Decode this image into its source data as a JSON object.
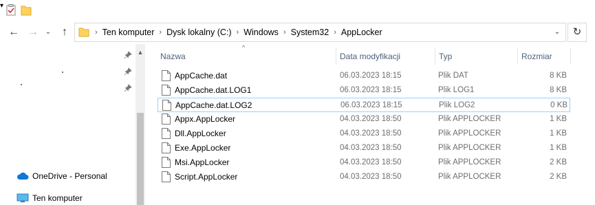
{
  "quick_access": {
    "icons": [
      "properties-icon",
      "new-folder-icon",
      "customize-dropdown-icon"
    ],
    "dropdown_glyph": "▾"
  },
  "nav": {
    "back_glyph": "←",
    "forward_glyph": "→",
    "recent_glyph": "⌄",
    "up_glyph": "↑",
    "refresh_glyph": "↻",
    "address_dropdown_glyph": "⌄",
    "breadcrumb": [
      "Ten komputer",
      "Dysk lokalny (C:)",
      "Windows",
      "System32",
      "AppLocker"
    ],
    "separator": "›"
  },
  "navpane": {
    "onedrive_label": "OneDrive - Personal",
    "computer_label": "Ten komputer",
    "scroll_up_glyph": "▲"
  },
  "columns": {
    "name": "Nazwa",
    "date": "Data modyfikacji",
    "type": "Typ",
    "size": "Rozmiar",
    "sort_glyph": "^"
  },
  "files": [
    {
      "name": "AppCache.dat",
      "date": "06.03.2023 18:15",
      "type": "Plik DAT",
      "size": "8 KB"
    },
    {
      "name": "AppCache.dat.LOG1",
      "date": "06.03.2023 18:15",
      "type": "Plik LOG1",
      "size": "8 KB"
    },
    {
      "name": "AppCache.dat.LOG2",
      "date": "06.03.2023 18:15",
      "type": "Plik LOG2",
      "size": "0 KB"
    },
    {
      "name": "Appx.AppLocker",
      "date": "04.03.2023 18:50",
      "type": "Plik APPLOCKER",
      "size": "1 KB"
    },
    {
      "name": "Dll.AppLocker",
      "date": "04.03.2023 18:50",
      "type": "Plik APPLOCKER",
      "size": "1 KB"
    },
    {
      "name": "Exe.AppLocker",
      "date": "04.03.2023 18:50",
      "type": "Plik APPLOCKER",
      "size": "1 KB"
    },
    {
      "name": "Msi.AppLocker",
      "date": "04.03.2023 18:50",
      "type": "Plik APPLOCKER",
      "size": "2 KB"
    },
    {
      "name": "Script.AppLocker",
      "date": "04.03.2023 18:50",
      "type": "Plik APPLOCKER",
      "size": "2 KB"
    }
  ],
  "selected_file": "AppCache.dat.LOG2",
  "colors": {
    "header_text": "#4c607a",
    "selection_border": "#99d1ff",
    "folder_yellow": "#ffd35c",
    "secondary_text": "#6d6d6d"
  }
}
